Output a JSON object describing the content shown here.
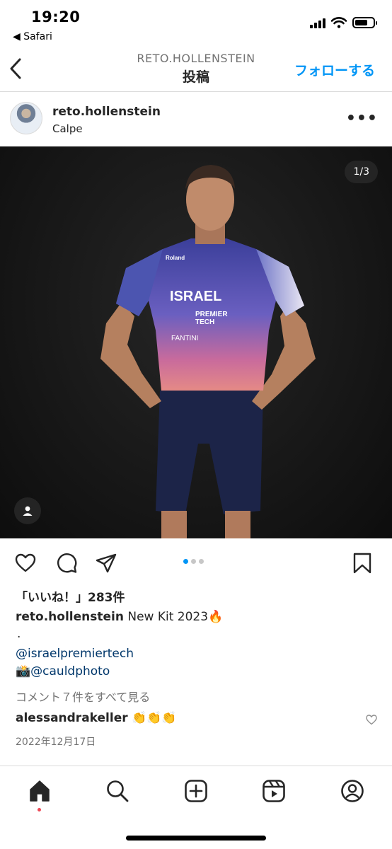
{
  "status_bar": {
    "time": "19:20",
    "back_app": "◀ Safari"
  },
  "header": {
    "username": "RETO.HOLLENSTEIN",
    "page_title": "投稿",
    "follow_label": "フォローする"
  },
  "post": {
    "author": "reto.hollenstein",
    "location": "Calpe",
    "more_label": "•••",
    "image_counter": "1/3",
    "image_count": 3,
    "current_image": 1,
    "jersey_texts": [
      "ISRAEL",
      "PREMIER",
      "TECH",
      "FANTINI",
      "Roland"
    ]
  },
  "engagement": {
    "likes": "「いいね！」283件",
    "caption_user": "reto.hollenstein",
    "caption_text": " New Kit 2023🔥",
    "caption_dot": ".",
    "mention_1": "@israelpremiertech",
    "mention_2": "📸@cauldphoto",
    "view_all_comments": "コメント７件をすべて見る",
    "comment_user": "alessandrakeller",
    "comment_text": " 👏👏👏",
    "date": "2022年12月17日"
  },
  "tabs": [
    "home",
    "search",
    "create",
    "reels",
    "profile"
  ],
  "colors": {
    "accent": "#0095f6",
    "mention": "#00376b",
    "notification": "#ed4956"
  }
}
